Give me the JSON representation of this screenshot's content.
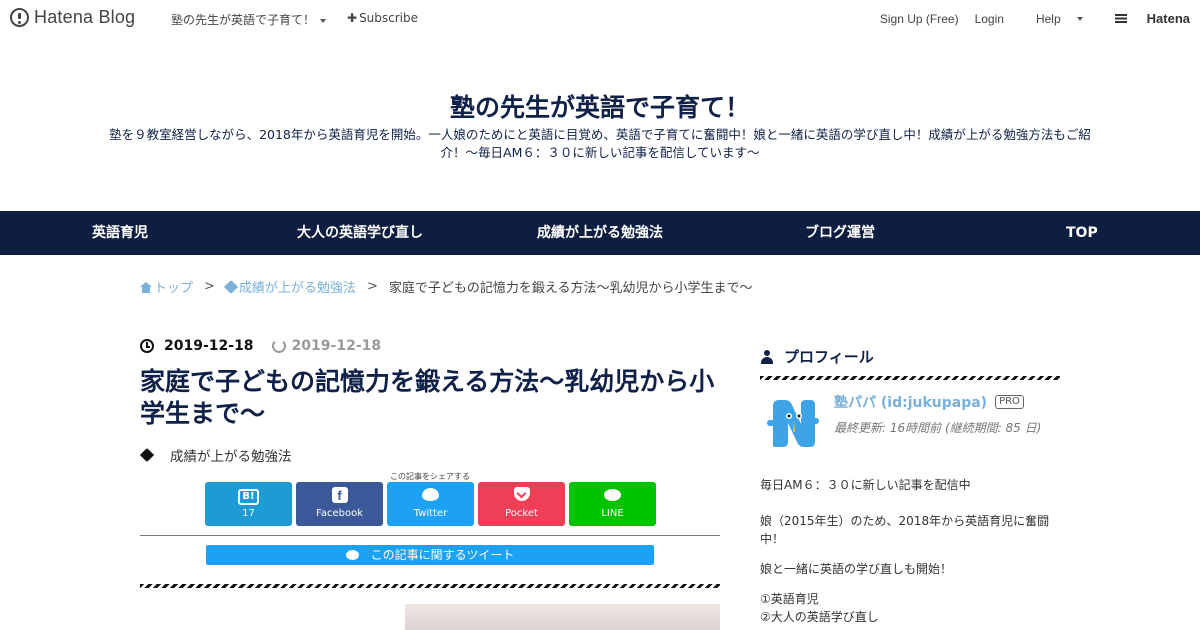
{
  "topbar": {
    "logo_text": "Hatena Blog",
    "blog_switch": "塾の先生が英語で子育て！",
    "subscribe": "Subscribe",
    "signup": "Sign Up (Free)",
    "login": "Login",
    "help": "Help",
    "hatena": "Hatena"
  },
  "header": {
    "title": "塾の先生が英語で子育て！",
    "description": "塾を９教室経営しながら、2018年から英語育児を開始。一人娘のためにと英語に目覚め、英語で子育てに奮闘中！娘と一緒に英語の学び直し中！成績が上がる勉強方法もご紹介！～毎日AM６：３０に新しい記事を配信しています～"
  },
  "nav": {
    "items": [
      {
        "label": "英語育児"
      },
      {
        "label": "大人の英語学び直し"
      },
      {
        "label": "成績が上がる勉強法"
      },
      {
        "label": "ブログ運営"
      },
      {
        "label": "TOP"
      }
    ]
  },
  "breadcrumb": {
    "home": "トップ",
    "category": "成績が上がる勉強法",
    "current": "家庭で子どもの記憶力を鍛える方法～乳幼児から小学生まで～",
    "separator": ">"
  },
  "article": {
    "date": "2019-12-18",
    "updated": "2019-12-18",
    "title": "家庭で子どもの記憶力を鍛える方法～乳幼児から小学生まで～",
    "category": "成績が上がる勉強法",
    "share_caption": "この記事をシェアする",
    "share": {
      "hatebu_icon": "B!",
      "hatebu_count": "17",
      "facebook": "Facebook",
      "twitter": "Twitter",
      "pocket": "Pocket",
      "line": "LINE"
    },
    "tweet_button": "この記事に関するツイート"
  },
  "sidebar": {
    "profile_heading": "プロフィール",
    "profile_name": "塾パパ (id:jukupapa)",
    "pro_badge": "PRO",
    "last_update": "最終更新: 16時間前 (継続期間: 85 日)",
    "lines": [
      "毎日AM６：３０に新しい記事を配信中",
      "娘（2015年生）のため、2018年から英語育児に奮闘中！",
      "娘と一緒に英語の学び直しも開始！",
      "①英語育児",
      "②大人の英語学び直し"
    ]
  },
  "colors": {
    "navy": "#0e1e40",
    "link_blue": "#7ab0d9",
    "hatebu": "#1d9bd7",
    "facebook": "#3b5998",
    "twitter": "#1da1f2",
    "pocket": "#ef3f56",
    "line": "#00c300"
  },
  "icons": {
    "logo": "hatena-blog-logo-icon",
    "date": "clock-icon",
    "updated": "refresh-icon",
    "category": "tag-icon",
    "profile": "user-icon"
  }
}
